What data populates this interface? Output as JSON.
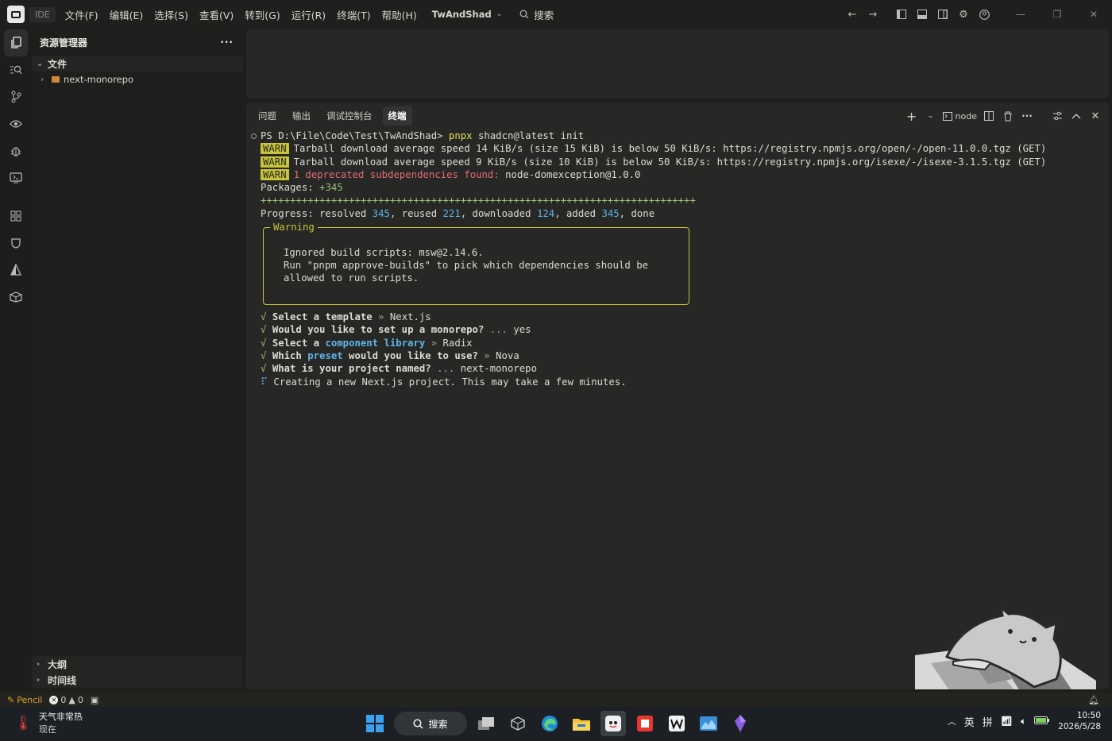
{
  "titlebar": {
    "ide_badge": "IDE",
    "menus": [
      "文件(F)",
      "编辑(E)",
      "选择(S)",
      "查看(V)",
      "转到(G)",
      "运行(R)",
      "终端(T)",
      "帮助(H)"
    ],
    "project": "TwAndShad",
    "search": "搜索"
  },
  "sidebar": {
    "title": "资源管理器",
    "files_section": "文件",
    "folder": "next-monorepo",
    "outline": "大纲",
    "timeline": "时间线"
  },
  "panel": {
    "tabs": [
      "问题",
      "输出",
      "调试控制台",
      "终端"
    ],
    "active_tab": "终端",
    "shell": "node"
  },
  "terminal": {
    "prompt": "PS D:\\File\\Code\\Test\\TwAndShad> ",
    "cmd1": "pnpx",
    "cmd2": " shadcn@latest init",
    "warn": "WARN",
    "warn1": "Tarball download average speed 14 KiB/s (size 15 KiB) is below 50 KiB/s: https://registry.npmjs.org/open/-/open-11.0.0.tgz (GET)",
    "warn2": "Tarball download average speed 9 KiB/s (size 10 KiB) is below 50 KiB/s: https://registry.npmjs.org/isexe/-/isexe-3.1.5.tgz (GET)",
    "warn3_a": "1 deprecated subdependencies found:",
    "warn3_b": " node-domexception@1.0.0",
    "packages_label": "Packages: ",
    "packages_value": "+345",
    "plus_line": "++++++++++++++++++++++++++++++++++++++++++++++++++++++++++++++++++++++++++",
    "progress_a": "Progress: resolved ",
    "resolved": "345",
    "progress_b": ", reused ",
    "reused": "221",
    "progress_c": ", downloaded ",
    "downloaded": "124",
    "progress_d": ", added ",
    "added": "345",
    "progress_e": ", done",
    "box_label": "Warning",
    "box_line1": "Ignored build scripts: msw@2.14.6.",
    "box_line2": "Run \"pnpm approve-builds\" to pick which dependencies should be",
    "box_line3": "allowed to run scripts.",
    "check": "√",
    "q1_label": "Select a template",
    "q1_sep": " » ",
    "q1_answer": "Next.js",
    "q2_label": "Would you like to set up a monorepo?",
    "q2_sep": " ... ",
    "q2_answer": "yes",
    "q3_a": "Select a ",
    "q3_b": "component library",
    "q3_sep": " » ",
    "q3_answer": "Radix",
    "q4_a": "Which ",
    "q4_b": "preset",
    "q4_c": " would you like to use?",
    "q4_sep": " » ",
    "q4_answer": "Nova",
    "q5_label": "What is your project named?",
    "q5_sep": " ... ",
    "q5_answer": "next-monorepo",
    "spinner": "⠏",
    "creating": "Creating a new Next.js project. This may take a few minutes."
  },
  "statusbar": {
    "pencil": "Pencil",
    "errors": "0",
    "warnings": "0"
  },
  "taskbar": {
    "weather_title": "天气非常热",
    "weather_sub": "现在",
    "search": "搜索",
    "ime1": "英",
    "ime2": "拼",
    "time": "10:50",
    "date": "2026/5/28"
  },
  "colors": {
    "warn_bg": "#c8c43a",
    "accent_blue": "#5fb6e8",
    "accent_yellow": "#e2de5a",
    "red": "#e06c75",
    "green": "#98c379"
  }
}
